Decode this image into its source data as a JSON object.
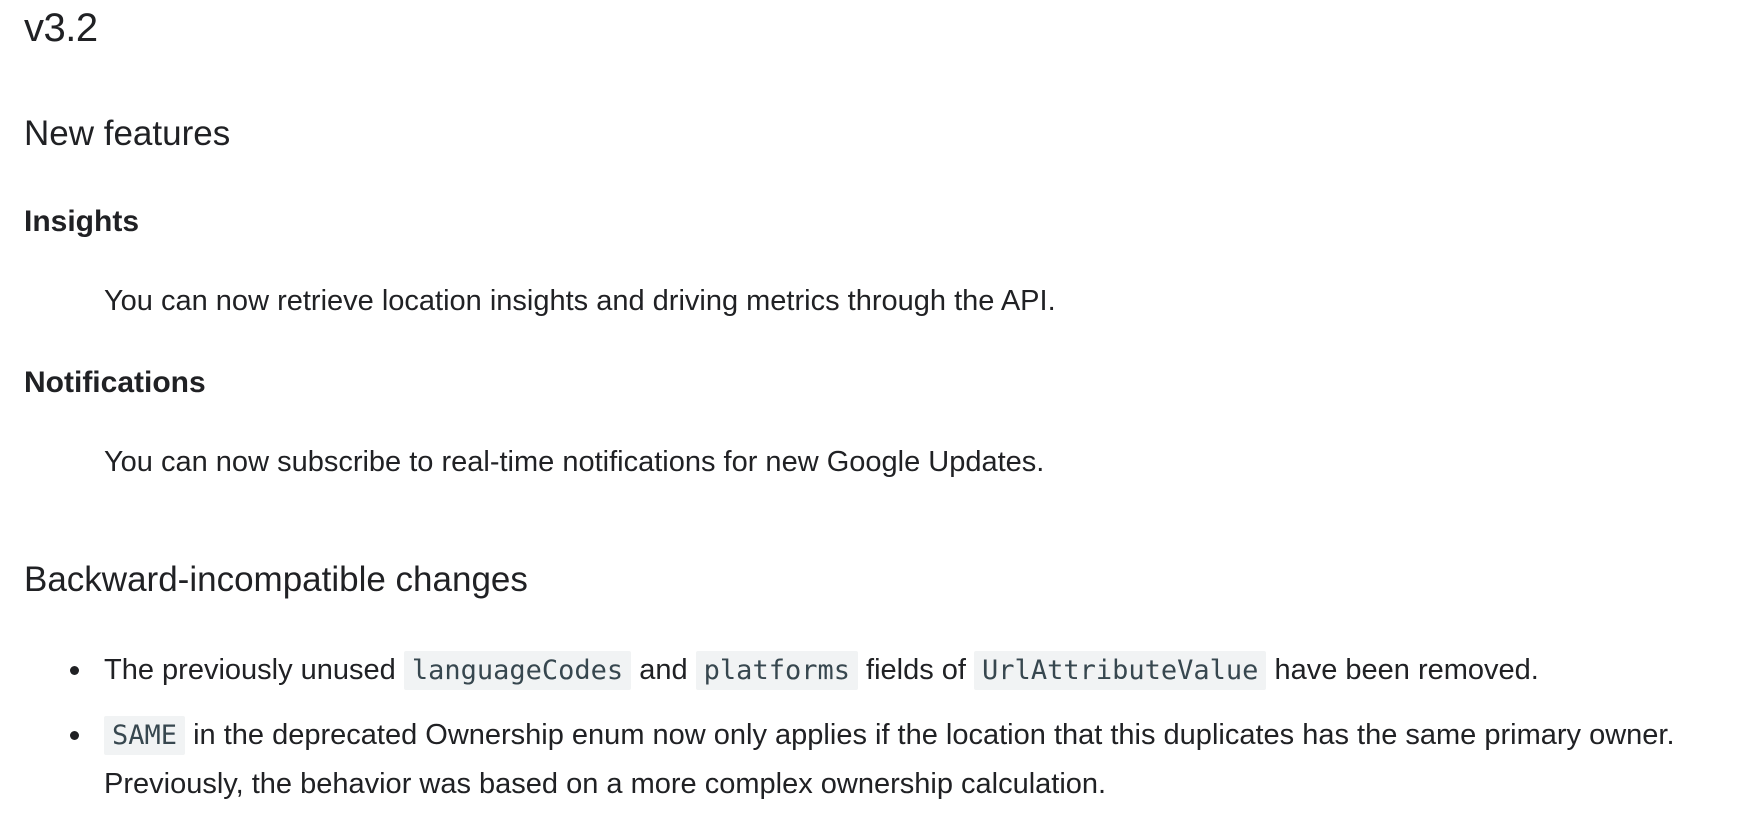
{
  "release": {
    "version": "v3.2"
  },
  "new_features": {
    "heading": "New features",
    "items": [
      {
        "name": "Insights",
        "description": "You can now retrieve location insights and driving metrics through the API."
      },
      {
        "name": "Notifications",
        "description": "You can now subscribe to real-time notifications for new Google Updates."
      }
    ]
  },
  "breaking_changes": {
    "heading": "Backward-incompatible changes",
    "item1": {
      "text_before": "The previously unused ",
      "code1": "languageCodes",
      "text_mid1": " and ",
      "code2": "platforms",
      "text_mid2": " fields of ",
      "code3": "UrlAttributeValue",
      "text_after": " have been removed."
    },
    "item2": {
      "code1": "SAME",
      "text_after": " in the deprecated Ownership enum now only applies if the location that this duplicates has the same primary owner. Previously, the behavior was based on a more complex ownership calculation."
    }
  }
}
